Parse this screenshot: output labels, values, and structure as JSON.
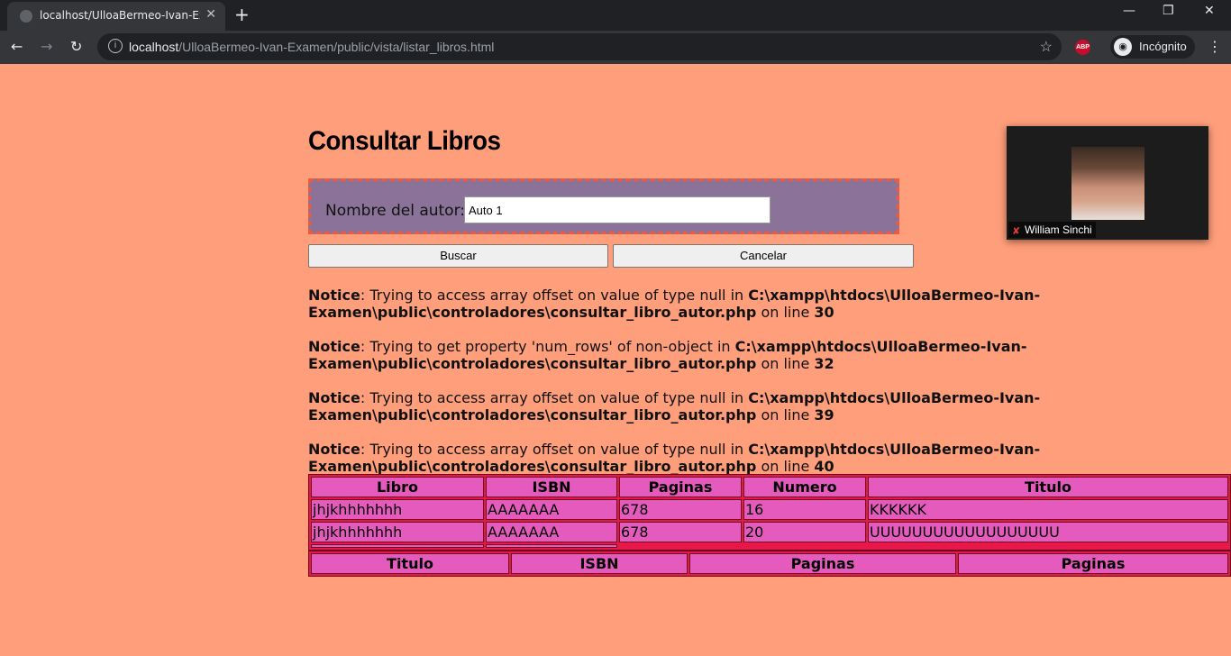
{
  "browser": {
    "tab_title": "localhost/UlloaBermeo-Ivan-Exar",
    "url_host": "localhost",
    "url_path": "/UlloaBermeo-Ivan-Examen/public/vista/listar_libros.html",
    "incognito_label": "Incógnito",
    "abp_label": "ABP"
  },
  "page": {
    "title": "Consultar Libros",
    "author_label": "Nombre del autor:",
    "author_value": "Auto 1",
    "search_button": "Buscar",
    "cancel_button": "Cancelar"
  },
  "notices": [
    {
      "label": "Notice",
      "message": ": Trying to access array offset on value of type null in ",
      "path": "C:\\xampp\\htdocs\\UlloaBermeo-Ivan-Examen\\public\\controladores\\consultar_libro_autor.php",
      "line_text": " on line ",
      "line": "30"
    },
    {
      "label": "Notice",
      "message": ": Trying to get property 'num_rows' of non-object in ",
      "path": "C:\\xampp\\htdocs\\UlloaBermeo-Ivan-Examen\\public\\controladores\\consultar_libro_autor.php",
      "line_text": " on line ",
      "line": "32"
    },
    {
      "label": "Notice",
      "message": ": Trying to access array offset on value of type null in ",
      "path": "C:\\xampp\\htdocs\\UlloaBermeo-Ivan-Examen\\public\\controladores\\consultar_libro_autor.php",
      "line_text": " on line ",
      "line": "39"
    },
    {
      "label": "Notice",
      "message": ": Trying to access array offset on value of type null in ",
      "path": "C:\\xampp\\htdocs\\UlloaBermeo-Ivan-Examen\\public\\controladores\\consultar_libro_autor.php",
      "line_text": " on line ",
      "line": "40"
    }
  ],
  "table1": {
    "headers": [
      "Libro",
      "ISBN",
      "Paginas",
      "Numero",
      "Titulo"
    ],
    "rows": [
      [
        "jhjkhhhhhhh",
        "AAAAAAA",
        "678",
        "16",
        "KKKKKK"
      ],
      [
        "jhjkhhhhhhh",
        "AAAAAAA",
        "678",
        "20",
        "UUUUUUUUUUUUUUUUUU"
      ]
    ]
  },
  "table2": {
    "headers": [
      "Titulo",
      "ISBN",
      "Paginas",
      "Paginas"
    ]
  },
  "video": {
    "participant": "William Sinchi"
  },
  "colors": {
    "page_bg": "#ff9e7a",
    "form_bg": "#8a7299",
    "form_border": "#f05a3a",
    "table_bg": "#e8174a",
    "cell_bg": "#e55bbd"
  }
}
